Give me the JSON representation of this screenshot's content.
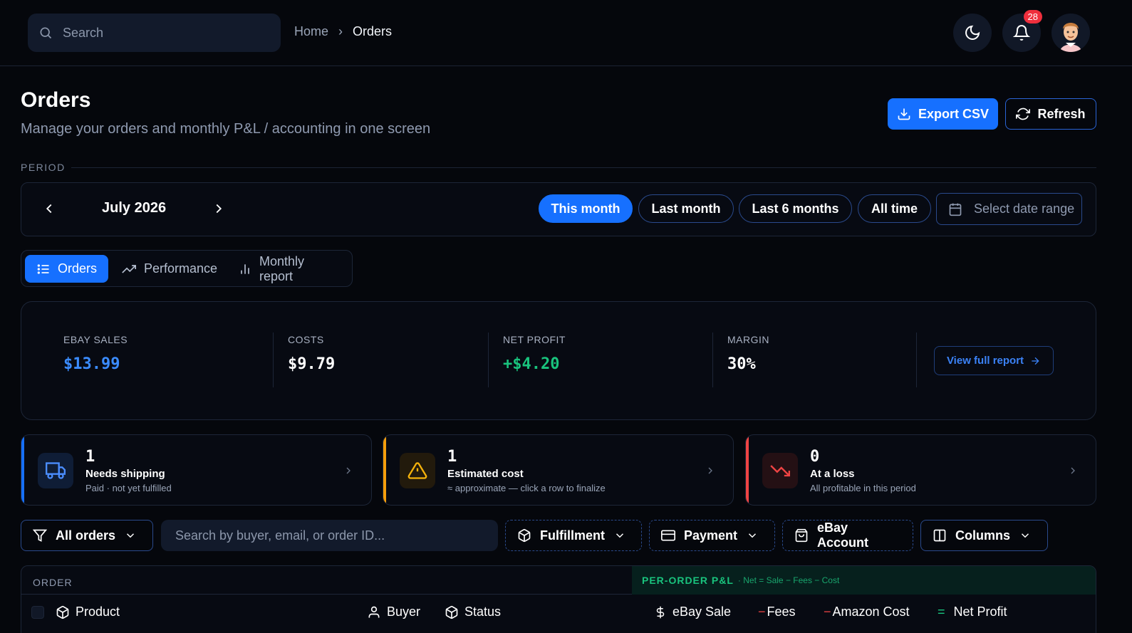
{
  "topbar": {
    "search_placeholder": "Search",
    "breadcrumb": {
      "home": "Home",
      "separator": "›",
      "current": "Orders"
    },
    "notifications_count": "28"
  },
  "header": {
    "title": "Orders",
    "subtitle": "Manage your orders and monthly P&L / accounting in one screen",
    "export_label": "Export CSV",
    "refresh_label": "Refresh"
  },
  "period": {
    "label": "PERIOD",
    "month": "July 2026",
    "pills": [
      {
        "label": "This month",
        "active": true
      },
      {
        "label": "Last month",
        "active": false
      },
      {
        "label": "Last 6 months",
        "active": false
      },
      {
        "label": "All time",
        "active": false
      }
    ],
    "date_range_placeholder": "Select date range"
  },
  "tabs": [
    {
      "label": "Orders",
      "active": true,
      "icon": "list-icon"
    },
    {
      "label": "Performance",
      "active": false,
      "icon": "trending-up-icon"
    },
    {
      "label": "Monthly report",
      "active": false,
      "icon": "bar-chart-icon"
    }
  ],
  "kpis": [
    {
      "label": "EBAY SALES",
      "value": "$13.99",
      "color": "#3b8cff"
    },
    {
      "label": "COSTS",
      "value": "$9.79",
      "color": "#ffffff"
    },
    {
      "label": "NET PROFIT",
      "value": "+$4.20",
      "color": "#19c37d"
    },
    {
      "label": "MARGIN",
      "value": "30%",
      "color": "#ffffff"
    }
  ],
  "view_report_label": "View full report",
  "stats": [
    {
      "num": "1",
      "title": "Needs shipping",
      "sub": "Paid · not yet fulfilled",
      "accent": "#1670ff",
      "icon": "truck-icon"
    },
    {
      "num": "1",
      "title": "Estimated cost",
      "sub": "≈ approximate — click a row to finalize",
      "accent": "#f59e0b",
      "icon": "warning-icon"
    },
    {
      "num": "0",
      "title": "At a loss",
      "sub": "All profitable in this period",
      "accent": "#ef4444",
      "icon": "trending-down-icon"
    }
  ],
  "filters": {
    "all_orders": "All orders",
    "search_placeholder": "Search by buyer, email, or order ID...",
    "fulfillment": "Fulfillment",
    "payment": "Payment",
    "ebay_account": "eBay Account",
    "columns": "Columns"
  },
  "table": {
    "group_order": "ORDER",
    "group_pl_title": "PER-ORDER P&L",
    "group_pl_formula": "· Net = Sale − Fees − Cost",
    "columns": {
      "product": "Product",
      "buyer": "Buyer",
      "status": "Status",
      "ebay_sale": "eBay Sale",
      "fees": "Fees",
      "amazon_cost": "Amazon Cost",
      "net_profit": "Net Profit"
    },
    "minus": "−",
    "equals": "="
  }
}
